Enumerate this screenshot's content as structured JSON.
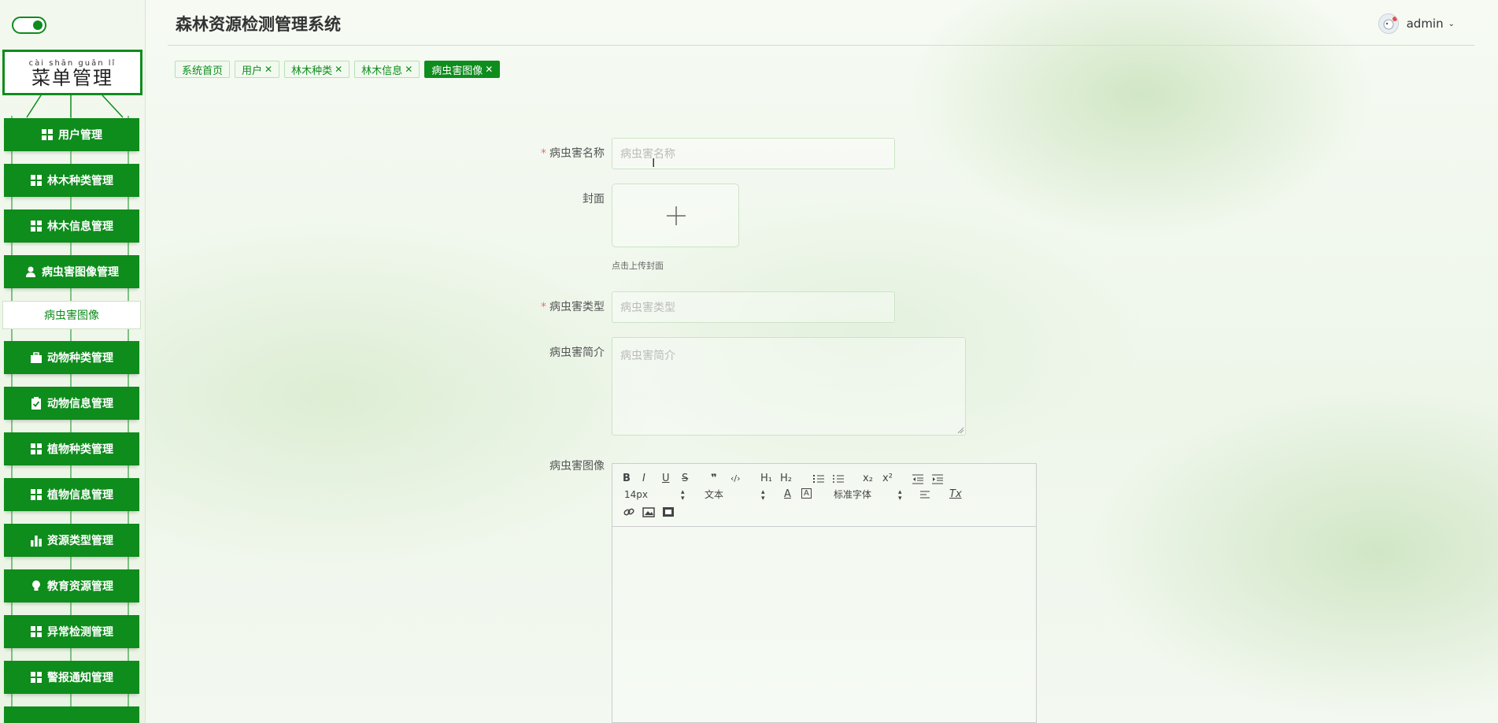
{
  "colors": {
    "primary": "#0e8c1c",
    "required": "#f56c6c"
  },
  "sidebar": {
    "title_pinyin": "cài shān guǎn lǐ",
    "title": "菜单管理",
    "items": [
      {
        "label": "用户管理",
        "icon": "grid-icon"
      },
      {
        "label": "林木种类管理",
        "icon": "grid-icon"
      },
      {
        "label": "林木信息管理",
        "icon": "grid-icon"
      },
      {
        "label": "病虫害图像管理",
        "icon": "user-icon"
      },
      {
        "label": "动物种类管理",
        "icon": "briefcase-icon"
      },
      {
        "label": "动物信息管理",
        "icon": "clipboard-check-icon"
      },
      {
        "label": "植物种类管理",
        "icon": "grid-icon"
      },
      {
        "label": "植物信息管理",
        "icon": "grid-icon"
      },
      {
        "label": "资源类型管理",
        "icon": "bar-chart-icon"
      },
      {
        "label": "教育资源管理",
        "icon": "lightbulb-icon"
      },
      {
        "label": "异常检测管理",
        "icon": "grid-icon"
      },
      {
        "label": "警报通知管理",
        "icon": "grid-icon"
      }
    ],
    "submenu": {
      "label": "病虫害图像"
    }
  },
  "header": {
    "title": "森林资源检测管理系统",
    "user": {
      "name": "admin"
    }
  },
  "tabs": [
    {
      "label": "系统首页",
      "closable": false,
      "active": false
    },
    {
      "label": "用户",
      "closable": true,
      "active": false
    },
    {
      "label": "林木种类",
      "closable": true,
      "active": false
    },
    {
      "label": "林木信息",
      "closable": true,
      "active": false
    },
    {
      "label": "病虫害图像",
      "closable": true,
      "active": true
    }
  ],
  "form": {
    "name": {
      "label": "病虫害名称",
      "placeholder": "病虫害名称",
      "required": true
    },
    "cover": {
      "label": "封面",
      "hint": "点击上传封面"
    },
    "type": {
      "label": "病虫害类型",
      "placeholder": "病虫害类型",
      "required": true
    },
    "intro": {
      "label": "病虫害简介",
      "placeholder": "病虫害简介"
    },
    "image": {
      "label": "病虫害图像",
      "toolbar": {
        "bold": "B",
        "italic": "I",
        "underline": "U",
        "strike": "S",
        "quote": "❞",
        "code": "‹/›",
        "h1": "H₁",
        "h2": "H₂",
        "sub": "x₂",
        "sup": "x²",
        "size": "14px",
        "paragraph": "文本",
        "font": "标准字体",
        "font_color": "A",
        "clear": "Tx"
      }
    }
  }
}
